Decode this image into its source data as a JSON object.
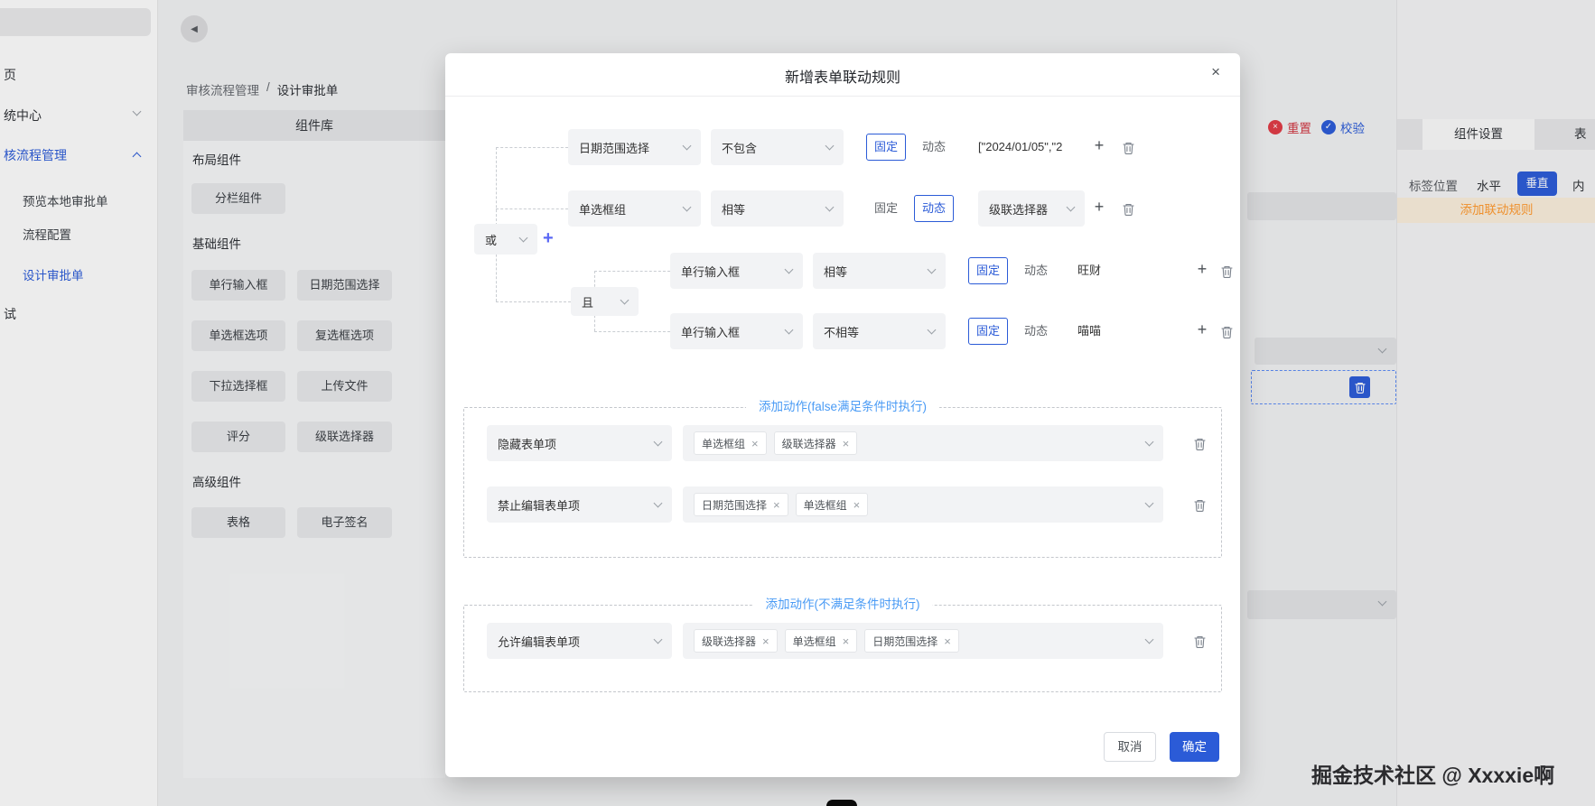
{
  "colors": {
    "primary": "#2b5bd7",
    "section_link": "#4a9bf5",
    "orange": "#ff9a2e",
    "red": "#e03a45"
  },
  "icons": {
    "back": "◀",
    "close": "×",
    "plus": "+",
    "tag_close": "×",
    "reset_glyph": "×",
    "validate_glyph": "✓"
  },
  "sidebar": {
    "items": [
      {
        "label": "页"
      },
      {
        "label": "统中心"
      },
      {
        "label": "核流程管理"
      },
      {
        "label": "预览本地审批单"
      },
      {
        "label": "流程配置"
      },
      {
        "label": "设计审批单"
      },
      {
        "label": "试"
      }
    ]
  },
  "breadcrumb": {
    "part1": "审核流程管理",
    "sep": "/",
    "part2": "设计审批单"
  },
  "toolbar": {
    "reset": "重置",
    "validate": "校验"
  },
  "library": {
    "title": "组件库",
    "groups": [
      {
        "label": "布局组件",
        "items": [
          "分栏组件"
        ]
      },
      {
        "label": "基础组件",
        "items": [
          "单行输入框",
          "日期范围选择",
          "单选框选项",
          "复选框选项",
          "下拉选择框",
          "上传文件",
          "评分",
          "级联选择器"
        ]
      },
      {
        "label": "高级组件",
        "items": [
          "表格",
          "电子签名"
        ]
      }
    ]
  },
  "right_panel": {
    "tab_component": "组件设置",
    "tab_form": "表",
    "label_position": "标签位置",
    "horizontal": "水平",
    "vertical": "垂直",
    "inline": "内",
    "add_rule": "添加联动规则"
  },
  "modal": {
    "title": "新增表单联动规则",
    "fixed": "固定",
    "dynamic": "动态",
    "root_logic": "或",
    "nested_logic": "且",
    "conditions": [
      {
        "field": "日期范围选择",
        "op": "不包含",
        "value": "[\"2024/01/05\",\"2"
      },
      {
        "field": "单选框组",
        "op": "相等",
        "value": "级联选择器"
      },
      {
        "field": "单行输入框",
        "op": "相等",
        "value": "旺财"
      },
      {
        "field": "单行输入框",
        "op": "不相等",
        "value": "喵喵"
      }
    ],
    "actions_false": {
      "title": "添加动作(false满足条件时执行)",
      "rows": [
        {
          "action": "隐藏表单项",
          "tags": [
            "单选框组",
            "级联选择器"
          ]
        },
        {
          "action": "禁止编辑表单项",
          "tags": [
            "日期范围选择",
            "单选框组"
          ]
        }
      ]
    },
    "actions_unmet": {
      "title": "添加动作(不满足条件时执行)",
      "rows": [
        {
          "action": "允许编辑表单项",
          "tags": [
            "级联选择器",
            "单选框组",
            "日期范围选择"
          ]
        }
      ]
    },
    "cancel": "取消",
    "confirm": "确定"
  },
  "watermark": "掘金技术社区 @ Xxxxie啊"
}
